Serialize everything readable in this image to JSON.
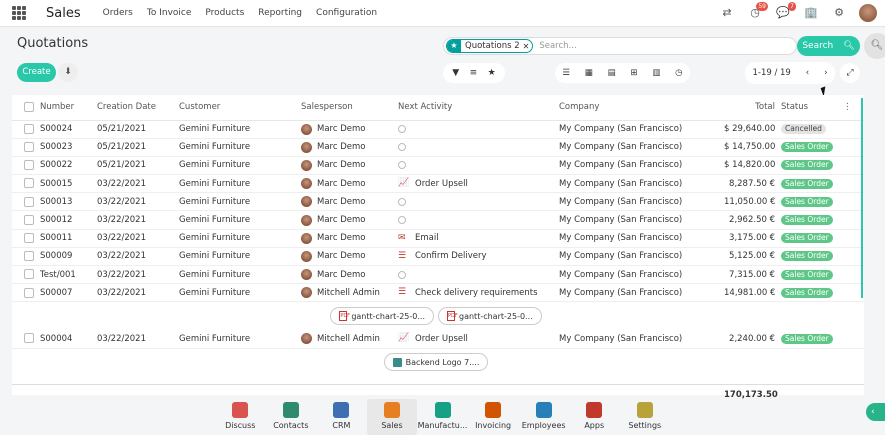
{
  "topbar": {
    "brand": "Sales",
    "menu": [
      "Orders",
      "To Invoice",
      "Products",
      "Reporting",
      "Configuration"
    ],
    "activity_badge": "59",
    "messages_badge": "7"
  },
  "control": {
    "title": "Quotations",
    "facet_label": "Quotations 2",
    "search_placeholder": "Search...",
    "search_button": "Search",
    "create_button": "Create",
    "pager": "1-19 / 19"
  },
  "table": {
    "headers": [
      "Number",
      "Creation Date",
      "Customer",
      "Salesperson",
      "Next Activity",
      "Company",
      "Total",
      "Status"
    ],
    "rows": [
      {
        "number": "S00024",
        "date": "05/21/2021",
        "customer": "Gemini Furniture",
        "salesperson": "Marc Demo",
        "activity": "",
        "activity_icon": "clock",
        "company": "My Company (San Francisco)",
        "total": "$ 29,640.00",
        "status": "Cancelled"
      },
      {
        "number": "S00023",
        "date": "05/21/2021",
        "customer": "Gemini Furniture",
        "salesperson": "Marc Demo",
        "activity": "",
        "activity_icon": "clock",
        "company": "My Company (San Francisco)",
        "total": "$ 14,750.00",
        "status": "Sales Order"
      },
      {
        "number": "S00022",
        "date": "05/21/2021",
        "customer": "Gemini Furniture",
        "salesperson": "Marc Demo",
        "activity": "",
        "activity_icon": "clock",
        "company": "My Company (San Francisco)",
        "total": "$ 14,820.00",
        "status": "Sales Order"
      },
      {
        "number": "S00015",
        "date": "03/22/2021",
        "customer": "Gemini Furniture",
        "salesperson": "Marc Demo",
        "activity": "Order Upsell",
        "activity_icon": "chart",
        "company": "My Company (San Francisco)",
        "total": "8,287.50 €",
        "status": "Sales Order"
      },
      {
        "number": "S00013",
        "date": "03/22/2021",
        "customer": "Gemini Furniture",
        "salesperson": "Marc Demo",
        "activity": "",
        "activity_icon": "clock",
        "company": "My Company (San Francisco)",
        "total": "11,050.00 €",
        "status": "Sales Order"
      },
      {
        "number": "S00012",
        "date": "03/22/2021",
        "customer": "Gemini Furniture",
        "salesperson": "Marc Demo",
        "activity": "",
        "activity_icon": "clock",
        "company": "My Company (San Francisco)",
        "total": "2,962.50 €",
        "status": "Sales Order"
      },
      {
        "number": "S00011",
        "date": "03/22/2021",
        "customer": "Gemini Furniture",
        "salesperson": "Marc Demo",
        "activity": "Email",
        "activity_icon": "email",
        "company": "My Company (San Francisco)",
        "total": "3,175.00 €",
        "status": "Sales Order"
      },
      {
        "number": "S00009",
        "date": "03/22/2021",
        "customer": "Gemini Furniture",
        "salesperson": "Marc Demo",
        "activity": "Confirm Delivery",
        "activity_icon": "todo",
        "company": "My Company (San Francisco)",
        "total": "5,125.00 €",
        "status": "Sales Order"
      },
      {
        "number": "Test/001",
        "date": "03/22/2021",
        "customer": "Gemini Furniture",
        "salesperson": "Marc Demo",
        "activity": "",
        "activity_icon": "clock",
        "company": "My Company (San Francisco)",
        "total": "7,315.00 €",
        "status": "Sales Order"
      },
      {
        "number": "S00007",
        "date": "03/22/2021",
        "customer": "Gemini Furniture",
        "salesperson": "Mitchell Admin",
        "activity": "Check delivery requirements",
        "activity_icon": "todo",
        "company": "My Company (San Francisco)",
        "total": "14,981.00 €",
        "status": "Sales Order"
      }
    ],
    "attachments_row1": [
      "gantt-chart-25-0...",
      "gantt-chart-25-0..."
    ],
    "row_after": {
      "number": "S00004",
      "date": "03/22/2021",
      "customer": "Gemini Furniture",
      "salesperson": "Mitchell Admin",
      "activity": "Order Upsell",
      "activity_icon": "chart",
      "company": "My Company (San Francisco)",
      "total": "2,240.00 €",
      "status": "Sales Order"
    },
    "attachments_row2": [
      "Backend Logo 7...."
    ],
    "grand_total": "170,173.50"
  },
  "dock": [
    {
      "label": "Discuss",
      "color": "#d9534f"
    },
    {
      "label": "Contacts",
      "color": "#2e8b6e"
    },
    {
      "label": "CRM",
      "color": "#3d6fb2"
    },
    {
      "label": "Sales",
      "color": "#e67e22"
    },
    {
      "label": "Manufactu...",
      "color": "#16a085"
    },
    {
      "label": "Invoicing",
      "color": "#d35400"
    },
    {
      "label": "Employees",
      "color": "#2980b9"
    },
    {
      "label": "Apps",
      "color": "#c0392b"
    },
    {
      "label": "Settings",
      "color": "#b8a33a"
    }
  ]
}
